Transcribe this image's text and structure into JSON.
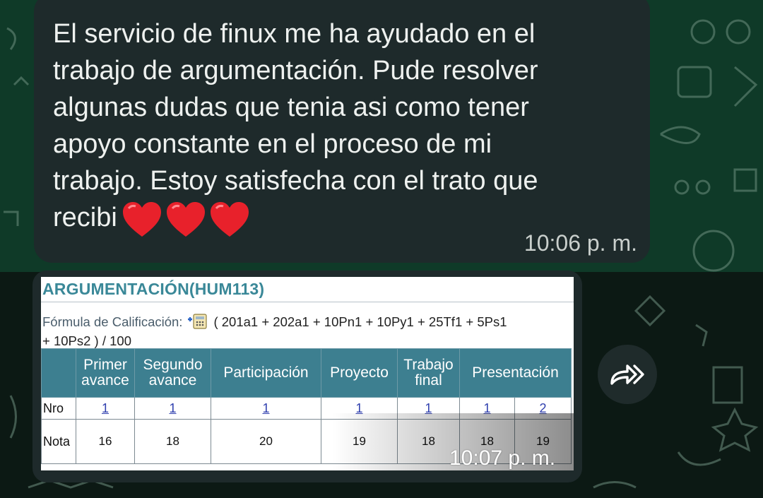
{
  "message": {
    "text_line1": "El servicio de finux me ha ayudado en el",
    "text_line2": "trabajo de argumentación. Pude resolver",
    "text_line3": "algunas dudas que tenia asi como tener",
    "text_line4": "apoyo constante en el proceso de mi",
    "text_line5": "trabajo. Estoy satisfecha con el trato que",
    "text_line6": "recibi",
    "emoji": [
      "red-heart",
      "red-heart",
      "red-heart"
    ],
    "time": "10:06 p. m."
  },
  "image_message": {
    "course_title": "ARGUMENTACIÓN(HUM113)",
    "formula_label": "Fórmula de Calificación:",
    "formula_line1": "( 201a1 + 202a1 + 10Pn1 + 10Py1 + 25Tf1 + 5Ps1",
    "formula_line2": "+ 10Ps2 ) / 100",
    "columns": [
      "",
      "Primer avance",
      "Segundo avance",
      "Participación",
      "Proyecto",
      "Trabajo final",
      "Presentación"
    ],
    "row_nro_label": "Nro",
    "row_nro": [
      "1",
      "1",
      "1",
      "1",
      "1",
      "1",
      "2"
    ],
    "row_nota_label": "Nota",
    "row_nota": [
      "16",
      "18",
      "20",
      "19",
      "18",
      "18",
      "19"
    ],
    "time": "10:07 p. m."
  },
  "colors": {
    "bubble": "#1e2a2b",
    "header_teal": "#3d7f90",
    "title_teal": "#3a8898",
    "heart": "#e8212b"
  },
  "icons": {
    "forward": "forward-arrow-icon",
    "calculator": "calculator-icon",
    "heart": "red-heart-emoji"
  }
}
